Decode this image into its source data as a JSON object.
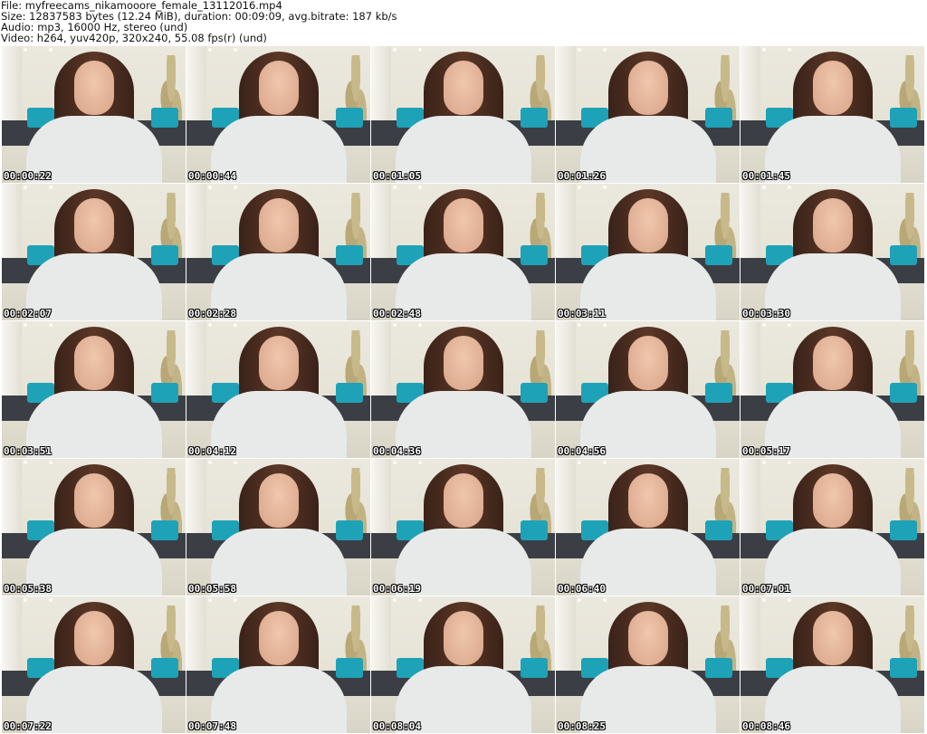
{
  "header": {
    "lines": [
      "File: myfreecams_nikamooore_female_13112016.mp4",
      "Size: 12837583 bytes (12.24 MiB), duration: 00:09:09, avg.bitrate: 187 kb/s",
      "Audio: mp3, 16000 Hz, stereo (und)",
      "Video: h264, yuv420p, 320x240, 55.08 fps(r) (und)"
    ]
  },
  "thumbnails": [
    "00:00:22",
    "00:00:44",
    "00:01:05",
    "00:01:26",
    "00:01:45",
    "00:02:07",
    "00:02:28",
    "00:02:48",
    "00:03:11",
    "00:03:30",
    "00:03:51",
    "00:04:12",
    "00:04:36",
    "00:04:56",
    "00:05:17",
    "00:05:38",
    "00:05:58",
    "00:06:19",
    "00:06:40",
    "00:07:01",
    "00:07:22",
    "00:07:48",
    "00:08:04",
    "00:08:25",
    "00:08:46"
  ],
  "colors": {
    "timestamp_text": "#ffffff",
    "timestamp_outline": "#000000",
    "sofa": "#3b3f45",
    "pillow": "#1ea2b7"
  }
}
